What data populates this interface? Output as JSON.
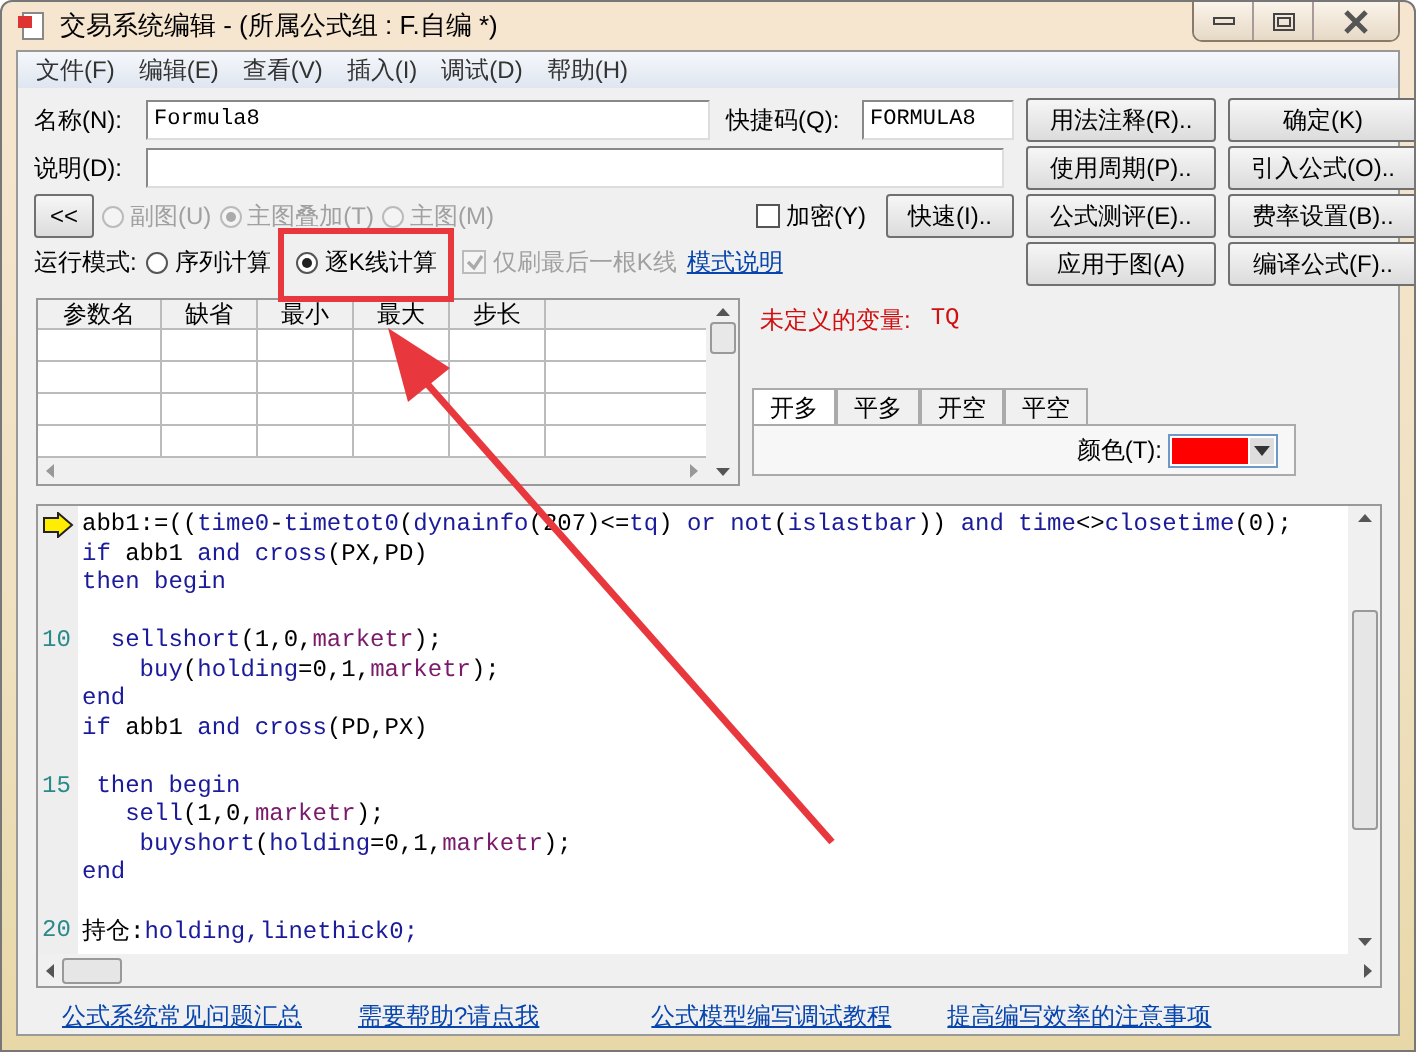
{
  "window": {
    "title": "交易系统编辑 - (所属公式组 : F.自编 *)"
  },
  "menu": [
    "文件(F)",
    "编辑(E)",
    "查看(V)",
    "插入(I)",
    "调试(D)",
    "帮助(H)"
  ],
  "form": {
    "name_label": "名称(N):",
    "name_value": "Formula8",
    "shortcut_label": "快捷码(Q):",
    "shortcut_value": "FORMULA8",
    "desc_label": "说明(D):"
  },
  "collapse_button": "<<",
  "chart_type": [
    {
      "label": "副图(U)",
      "selected": false,
      "disabled": true
    },
    {
      "label": "主图叠加(T)",
      "selected": true,
      "disabled": true
    },
    {
      "label": "主图(M)",
      "selected": false,
      "disabled": true
    }
  ],
  "encrypt": {
    "label": "加密(Y)",
    "checked": false
  },
  "quick_button": "快速(I)..",
  "run_mode": {
    "label": "运行模式:",
    "options": [
      {
        "label": "序列计算",
        "selected": false
      },
      {
        "label": "逐K线计算",
        "selected": true
      }
    ],
    "last_bar": {
      "label": "仅刷最后一根K线",
      "checked": true,
      "disabled": true
    },
    "link": "模式说明"
  },
  "buttons": [
    "用法注释(R)..",
    "确定(K)",
    "使用周期(P)..",
    "引入公式(O)..",
    "公式测评(E)..",
    "费率设置(B)..",
    "应用于图(A)",
    "编译公式(F).."
  ],
  "params_table": {
    "columns": [
      "参数名",
      "缺省",
      "最小",
      "最大",
      "步长"
    ]
  },
  "error": {
    "label": "未定义的变量:",
    "value": "TQ"
  },
  "signal_tabs": [
    {
      "label": "开多",
      "selected": true
    },
    {
      "label": "平多",
      "selected": false
    },
    {
      "label": "开空",
      "selected": false
    },
    {
      "label": "平空",
      "selected": false
    }
  ],
  "color_field": {
    "label": "颜色(T):",
    "color": "#ff0000"
  },
  "code_lines": [
    {
      "current": true,
      "segments": [
        {
          "kind": "plain",
          "text": "abb1:=(("
        },
        {
          "kind": "keyword",
          "text": "time0"
        },
        {
          "kind": "plain",
          "text": "-"
        },
        {
          "kind": "keyword",
          "text": "timetot0"
        },
        {
          "kind": "plain",
          "text": "("
        },
        {
          "kind": "keyword",
          "text": "dynainfo"
        },
        {
          "kind": "plain",
          "text": "(207)<="
        },
        {
          "kind": "keyword",
          "text": "tq"
        },
        {
          "kind": "plain",
          "text": ") "
        },
        {
          "kind": "keyword",
          "text": "or not"
        },
        {
          "kind": "plain",
          "text": "("
        },
        {
          "kind": "keyword",
          "text": "islastbar"
        },
        {
          "kind": "plain",
          "text": ")) "
        },
        {
          "kind": "keyword",
          "text": "and time"
        },
        {
          "kind": "plain",
          "text": "<>"
        },
        {
          "kind": "keyword",
          "text": "closetime"
        },
        {
          "kind": "plain",
          "text": "(0);"
        }
      ]
    },
    {
      "current": false,
      "segments": [
        {
          "kind": "keyword",
          "text": "if"
        },
        {
          "kind": "plain",
          "text": " abb1 "
        },
        {
          "kind": "keyword",
          "text": "and cross"
        },
        {
          "kind": "plain",
          "text": "(PX,PD)"
        }
      ]
    },
    {
      "current": false,
      "segments": [
        {
          "kind": "keyword",
          "text": "then begin"
        }
      ]
    },
    {
      "current": false
    },
    {
      "current": false,
      "number": "10",
      "segments": [
        {
          "kind": "keyword",
          "text": "  sellshort"
        },
        {
          "kind": "plain",
          "text": "(1,0,"
        },
        {
          "kind": "constant",
          "text": "marketr"
        },
        {
          "kind": "plain",
          "text": ");"
        }
      ]
    },
    {
      "current": false,
      "segments": [
        {
          "kind": "keyword",
          "text": "    buy"
        },
        {
          "kind": "plain",
          "text": "("
        },
        {
          "kind": "keyword",
          "text": "holding"
        },
        {
          "kind": "plain",
          "text": "=0,1,"
        },
        {
          "kind": "constant",
          "text": "marketr"
        },
        {
          "kind": "plain",
          "text": ");"
        }
      ]
    },
    {
      "current": false,
      "segments": [
        {
          "kind": "keyword",
          "text": "end"
        }
      ]
    },
    {
      "current": false,
      "segments": [
        {
          "kind": "keyword",
          "text": "if"
        },
        {
          "kind": "plain",
          "text": " abb1 "
        },
        {
          "kind": "keyword",
          "text": "and cross"
        },
        {
          "kind": "plain",
          "text": "(PD,PX)"
        }
      ]
    },
    {
      "current": false
    },
    {
      "current": false,
      "number": "15",
      "segments": [
        {
          "kind": "keyword",
          "text": " then begin"
        }
      ]
    },
    {
      "current": false,
      "segments": [
        {
          "kind": "keyword",
          "text": "   sell"
        },
        {
          "kind": "plain",
          "text": "(1,0,"
        },
        {
          "kind": "constant",
          "text": "marketr"
        },
        {
          "kind": "plain",
          "text": ");"
        }
      ]
    },
    {
      "current": false,
      "segments": [
        {
          "kind": "keyword",
          "text": "    buyshort"
        },
        {
          "kind": "plain",
          "text": "("
        },
        {
          "kind": "keyword",
          "text": "holding"
        },
        {
          "kind": "plain",
          "text": "=0,1,"
        },
        {
          "kind": "constant",
          "text": "marketr"
        },
        {
          "kind": "plain",
          "text": ");"
        }
      ]
    },
    {
      "current": false,
      "segments": [
        {
          "kind": "keyword",
          "text": "end"
        }
      ]
    },
    {
      "current": false
    },
    {
      "current": false,
      "number": "20",
      "segments": [
        {
          "kind": "plain",
          "text": "持仓:"
        },
        {
          "kind": "keyword",
          "text": "holding,linethick0;"
        }
      ]
    }
  ],
  "footer_links": [
    "公式系统常见问题汇总",
    "需要帮助?请点我",
    "公式模型编写调试教程",
    "提高编写效率的注意事项"
  ]
}
